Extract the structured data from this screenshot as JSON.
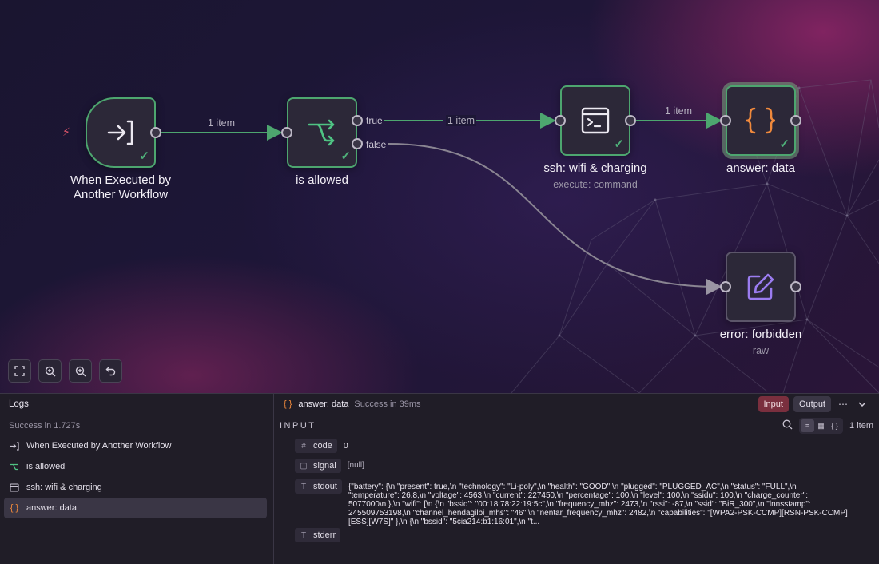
{
  "workflow": {
    "nodes": [
      {
        "id": "trigger",
        "label_lines": [
          "When Executed by",
          "Another Workflow"
        ],
        "icon": "arrow-into-bracket-icon"
      },
      {
        "id": "if",
        "label": "is allowed",
        "icon": "branch-split-icon"
      },
      {
        "id": "ssh",
        "label": "ssh: wifi & charging",
        "subtitle": "execute: command",
        "icon": "terminal-icon"
      },
      {
        "id": "answer",
        "label": "answer: data",
        "icon": "curly-braces-icon"
      },
      {
        "id": "error",
        "label": "error: forbidden",
        "subtitle": "raw",
        "icon": "edit-pen-icon"
      }
    ],
    "edges": {
      "trigger_to_if": "1 item",
      "true_to_ssh": "1 item",
      "ssh_to_answer": "1 item"
    },
    "branches": {
      "true": "true",
      "false": "false"
    },
    "colors": {
      "success": "#4da66f",
      "edge": "#4da66f",
      "edge_inactive": "#8a8592",
      "accent": "#e07b39",
      "edit": "#9b7cf0"
    }
  },
  "logs": {
    "title": "Logs",
    "status": "Success in 1.727s",
    "items": [
      {
        "label": "When Executed by Another Workflow",
        "icon": "arrow-into-bracket-icon"
      },
      {
        "label": "is allowed",
        "icon": "branch-split-icon"
      },
      {
        "label": "ssh: wifi & charging",
        "icon": "terminal-icon"
      },
      {
        "label": "answer: data",
        "icon": "curly-braces-icon",
        "active": true
      }
    ]
  },
  "detail": {
    "node_title": "answer: data",
    "status": "Success in 39ms",
    "input_tab": "Input",
    "output_tab": "Output",
    "more": "⋯",
    "section": "INPUT",
    "count": "1 item",
    "fields": [
      {
        "key": "code",
        "type": "#",
        "value": "0"
      },
      {
        "key": "signal",
        "type": "▢",
        "value": "[null]"
      },
      {
        "key": "stdout",
        "type": "T",
        "value_lines": [
          "{\"battery\": {\\n \"present\": true,\\n \"technology\": \"Li-poly\",\\n \"health\": \"GOOD\",\\n \"plugged\": \"PLUGGED_AC\",\\n \"status\": \"FULL\",\\n",
          "\"temperature\": 26.8,\\n \"voltage\": 4563,\\n \"current\": 227450,\\n \"percentage\": 100,\\n \"level\": 100,\\n \"ssidu\": 100,\\n \"charge_counter\":",
          "5077000\\n },\\n \"wifi\": [\\n {\\n \"bssid\": \"00:18:78:22:19:5c\",\\n \"frequency_mhz\": 2473,\\n \"rssi\": -87,\\n \"ssid\": \"BiR_300\",\\n \"lnnsstamp\":",
          "245509753198,\\n \"channel_hendagilbi_mhs\": \"46\",\\n \"nentar_frequency_mhz\": 2482,\\n \"capabilities\": \"[WPA2-PSK-CCMP][RSN-PSK-CCMP]",
          "[ESS][W7S]\" },\\n {\\n \"bssid\": \"5cia214:b1:16:01\",\\n \"t..."
        ]
      },
      {
        "key": "stderr",
        "type": "T",
        "value": ""
      }
    ]
  }
}
